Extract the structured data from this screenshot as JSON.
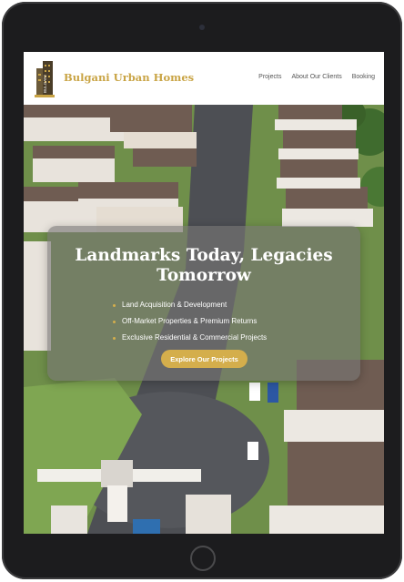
{
  "brand": {
    "name": "Bulgani Urban Homes",
    "logo_text": "BULGANI",
    "accent_color": "#d4ae4c"
  },
  "nav": {
    "items": [
      {
        "label": "Projects"
      },
      {
        "label": "About Our Clients"
      },
      {
        "label": "Booking"
      }
    ]
  },
  "hero": {
    "headline": "Landmarks Today, Legacies Tomorrow",
    "bullets": [
      {
        "text": "Land Acquisition & Development"
      },
      {
        "text": "Off-Market Properties & Premium Returns"
      },
      {
        "text": "Exclusive Residential & Commercial Projects"
      }
    ],
    "cta_label": "Explore Our Projects"
  }
}
